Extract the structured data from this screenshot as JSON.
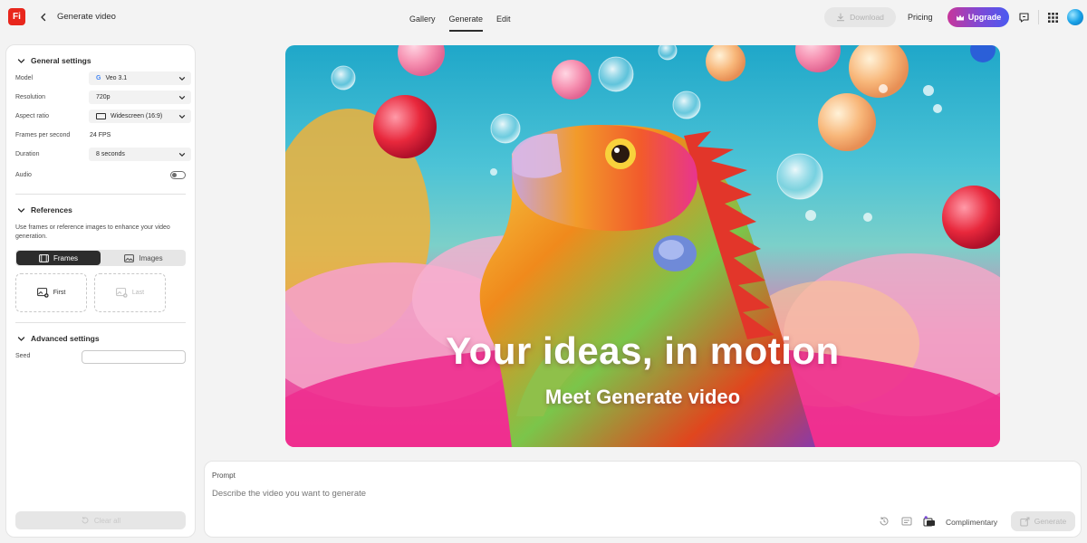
{
  "app": {
    "logo_text": "Fi",
    "page_title": "Generate video"
  },
  "nav": {
    "tabs": [
      {
        "label": "Gallery"
      },
      {
        "label": "Generate"
      },
      {
        "label": "Edit"
      }
    ],
    "active_tab": "Generate"
  },
  "header": {
    "download_label": "Download",
    "pricing_label": "Pricing",
    "upgrade_label": "Upgrade"
  },
  "general_settings": {
    "title": "General settings",
    "model": {
      "label": "Model",
      "value": "Veo 3.1"
    },
    "resolution": {
      "label": "Resolution",
      "value": "720p"
    },
    "aspect_ratio": {
      "label": "Aspect ratio",
      "value": "Widescreen (16:9)"
    },
    "fps": {
      "label": "Frames per second",
      "value": "24 FPS"
    },
    "duration": {
      "label": "Duration",
      "value": "8 seconds"
    },
    "audio": {
      "label": "Audio",
      "enabled": false
    }
  },
  "references": {
    "title": "References",
    "description": "Use frames or reference images to enhance your video generation.",
    "tabs": [
      {
        "label": "Frames"
      },
      {
        "label": "Images"
      }
    ],
    "active_tab": "Frames",
    "slots": [
      {
        "label": "First"
      },
      {
        "label": "Last"
      }
    ]
  },
  "advanced_settings": {
    "title": "Advanced settings",
    "seed": {
      "label": "Seed",
      "value": ""
    }
  },
  "clear_all_label": "Clear all",
  "hero": {
    "title": "Your ideas, in motion",
    "subtitle": "Meet Generate video"
  },
  "prompt": {
    "label": "Prompt",
    "placeholder": "Describe the video you want to generate",
    "complimentary_label": "Complimentary",
    "generate_label": "Generate"
  },
  "colors": {
    "accent": "#e8261c",
    "upgrade_gradient_start": "#c7369b",
    "upgrade_gradient_end": "#4a5af0",
    "active_segment": "#2c2c2c"
  }
}
